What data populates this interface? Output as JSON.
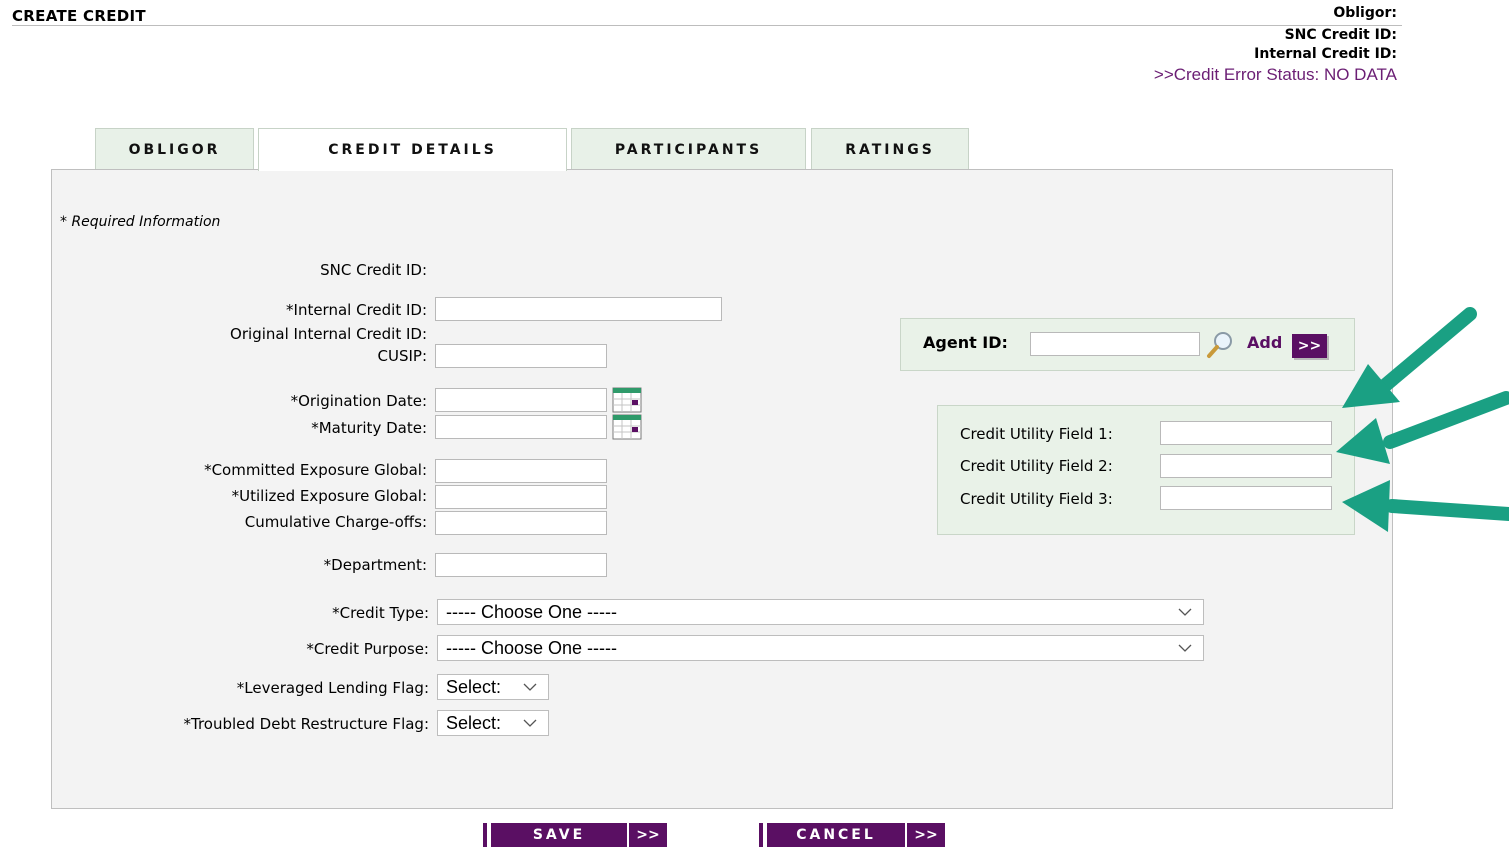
{
  "header": {
    "title": "CREATE CREDIT",
    "obligor": "Obligor:",
    "snc_credit_id": "SNC Credit ID:",
    "internal_credit_id": "Internal Credit ID:",
    "error_status": ">>Credit Error Status: NO DATA"
  },
  "tabs": [
    {
      "label": "OBLIGOR",
      "active": false
    },
    {
      "label": "CREDIT DETAILS",
      "active": true
    },
    {
      "label": "PARTICIPANTS",
      "active": false
    },
    {
      "label": "RATINGS",
      "active": false
    }
  ],
  "form": {
    "required_note": "* Required Information",
    "snc_credit_id_label": "SNC Credit ID:",
    "internal_credit_id_label": "*Internal Credit ID:",
    "original_internal_credit_id_label": "Original Internal Credit ID:",
    "cusip_label": "CUSIP:",
    "origination_date_label": "*Origination Date:",
    "maturity_date_label": "*Maturity Date:",
    "committed_exposure_label": "*Committed Exposure Global:",
    "utilized_exposure_label": "*Utilized Exposure Global:",
    "charge_offs_label": "Cumulative Charge-offs:",
    "department_label": "*Department:",
    "credit_type_label": "*Credit Type:",
    "credit_type_value": "----- Choose One -----",
    "credit_purpose_label": "*Credit Purpose:",
    "credit_purpose_value": "----- Choose One -----",
    "leveraged_label": "*Leveraged Lending Flag:",
    "leveraged_value": "Select:",
    "troubled_label": "*Troubled Debt Restructure Flag:",
    "troubled_value": "Select:"
  },
  "agent": {
    "label": "Agent ID:",
    "add_label": "Add",
    "go_label": ">>"
  },
  "utility": {
    "field1_label": "Credit Utility Field 1:",
    "field2_label": "Credit Utility Field 2:",
    "field3_label": "Credit Utility Field 3:"
  },
  "buttons": {
    "save": "SAVE",
    "cancel": "CANCEL",
    "arrow": ">>"
  },
  "colors": {
    "accent": "#5a0f63",
    "error_text": "#6b1e74",
    "tab_bg": "#e8f1e8",
    "annotation_arrow": "#1aa083"
  }
}
